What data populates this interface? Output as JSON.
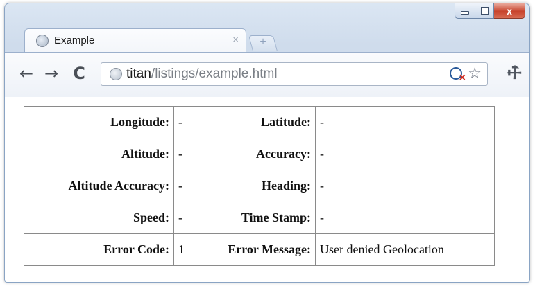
{
  "tab": {
    "title": "Example",
    "close": "×",
    "new_tab": "+"
  },
  "toolbar": {
    "back": "←",
    "forward": "→",
    "reload": "C",
    "url_host": "titan",
    "url_path": "/listings/example.html",
    "star": "☆",
    "wrench": "🔧"
  },
  "window": {
    "minimize": "",
    "maximize": "",
    "close": "x"
  },
  "geo": {
    "rows": [
      {
        "label1": "Longitude:",
        "value1": "-",
        "label2": "Latitude:",
        "value2": "-"
      },
      {
        "label1": "Altitude:",
        "value1": "-",
        "label2": "Accuracy:",
        "value2": "-"
      },
      {
        "label1": "Altitude Accuracy:",
        "value1": "-",
        "label2": "Heading:",
        "value2": "-"
      },
      {
        "label1": "Speed:",
        "value1": "-",
        "label2": "Time Stamp:",
        "value2": "-"
      },
      {
        "label1": "Error Code:",
        "value1": "1",
        "label2": "Error Message:",
        "value2": "User denied Geolocation"
      }
    ]
  }
}
